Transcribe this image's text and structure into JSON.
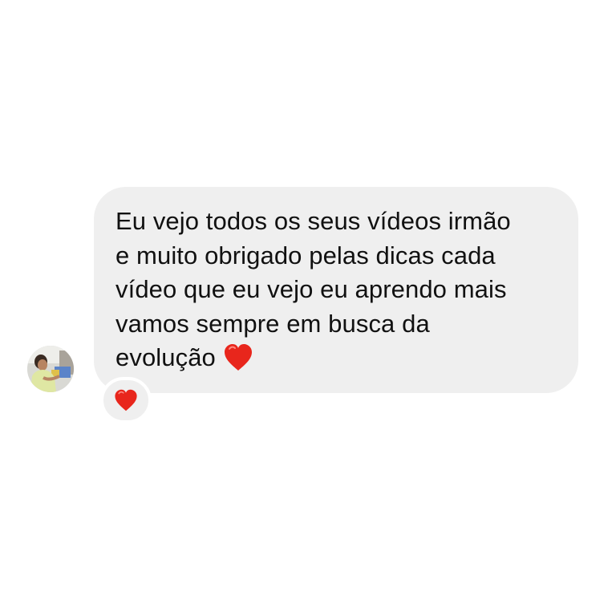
{
  "message": {
    "lines": [
      "Eu vejo todos os seus vídeos irmão",
      "e muito obrigado pelas dicas cada",
      "vídeo que eu vejo eu aprendo mais",
      "vamos sempre em busca da",
      "evolução"
    ],
    "inline_emoji": "heart-icon"
  },
  "reaction": {
    "emoji": "heart-icon"
  },
  "colors": {
    "bubble_background": "#efefef",
    "text": "#111111",
    "heart": "#e8261c",
    "page_background": "#ffffff"
  },
  "avatar": {
    "icon": "profile-photo"
  }
}
